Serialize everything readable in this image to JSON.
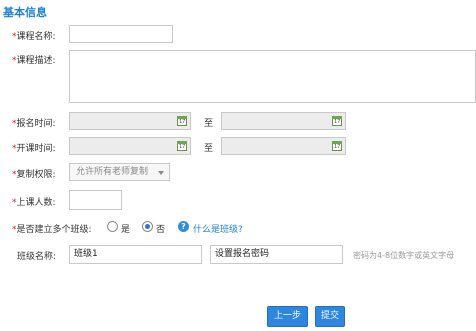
{
  "section": {
    "title": "基本信息"
  },
  "form": {
    "required_mark": "*",
    "course_name": {
      "label": "课程名称:",
      "value": ""
    },
    "course_desc": {
      "label": "课程描述:",
      "value": ""
    },
    "signup_time": {
      "label": "报名时间:",
      "to": "至",
      "start": "",
      "end": ""
    },
    "class_time": {
      "label": "开课时间:",
      "to": "至",
      "start": "",
      "end": ""
    },
    "copy_permission": {
      "label": "复制权限:",
      "selected": "允许所有老师复制"
    },
    "class_size": {
      "label": "上课人数:",
      "value": ""
    },
    "multi_class": {
      "label": "是否建立多个班级:",
      "yes_label": "是",
      "no_label": "否",
      "selected": "否",
      "help_link": "什么是班级?"
    },
    "class_name": {
      "label": "班级名称:",
      "value": "班级1",
      "password_value": "设置报名密码",
      "hint": "密码为4-8位数字或英文字母"
    }
  },
  "calendar_icon_text": "17",
  "buttons": {
    "prev": "上一步",
    "submit": "提交"
  },
  "colors": {
    "accent": "#2e86de",
    "title": "#1e7fd0",
    "required": "#e02020"
  }
}
